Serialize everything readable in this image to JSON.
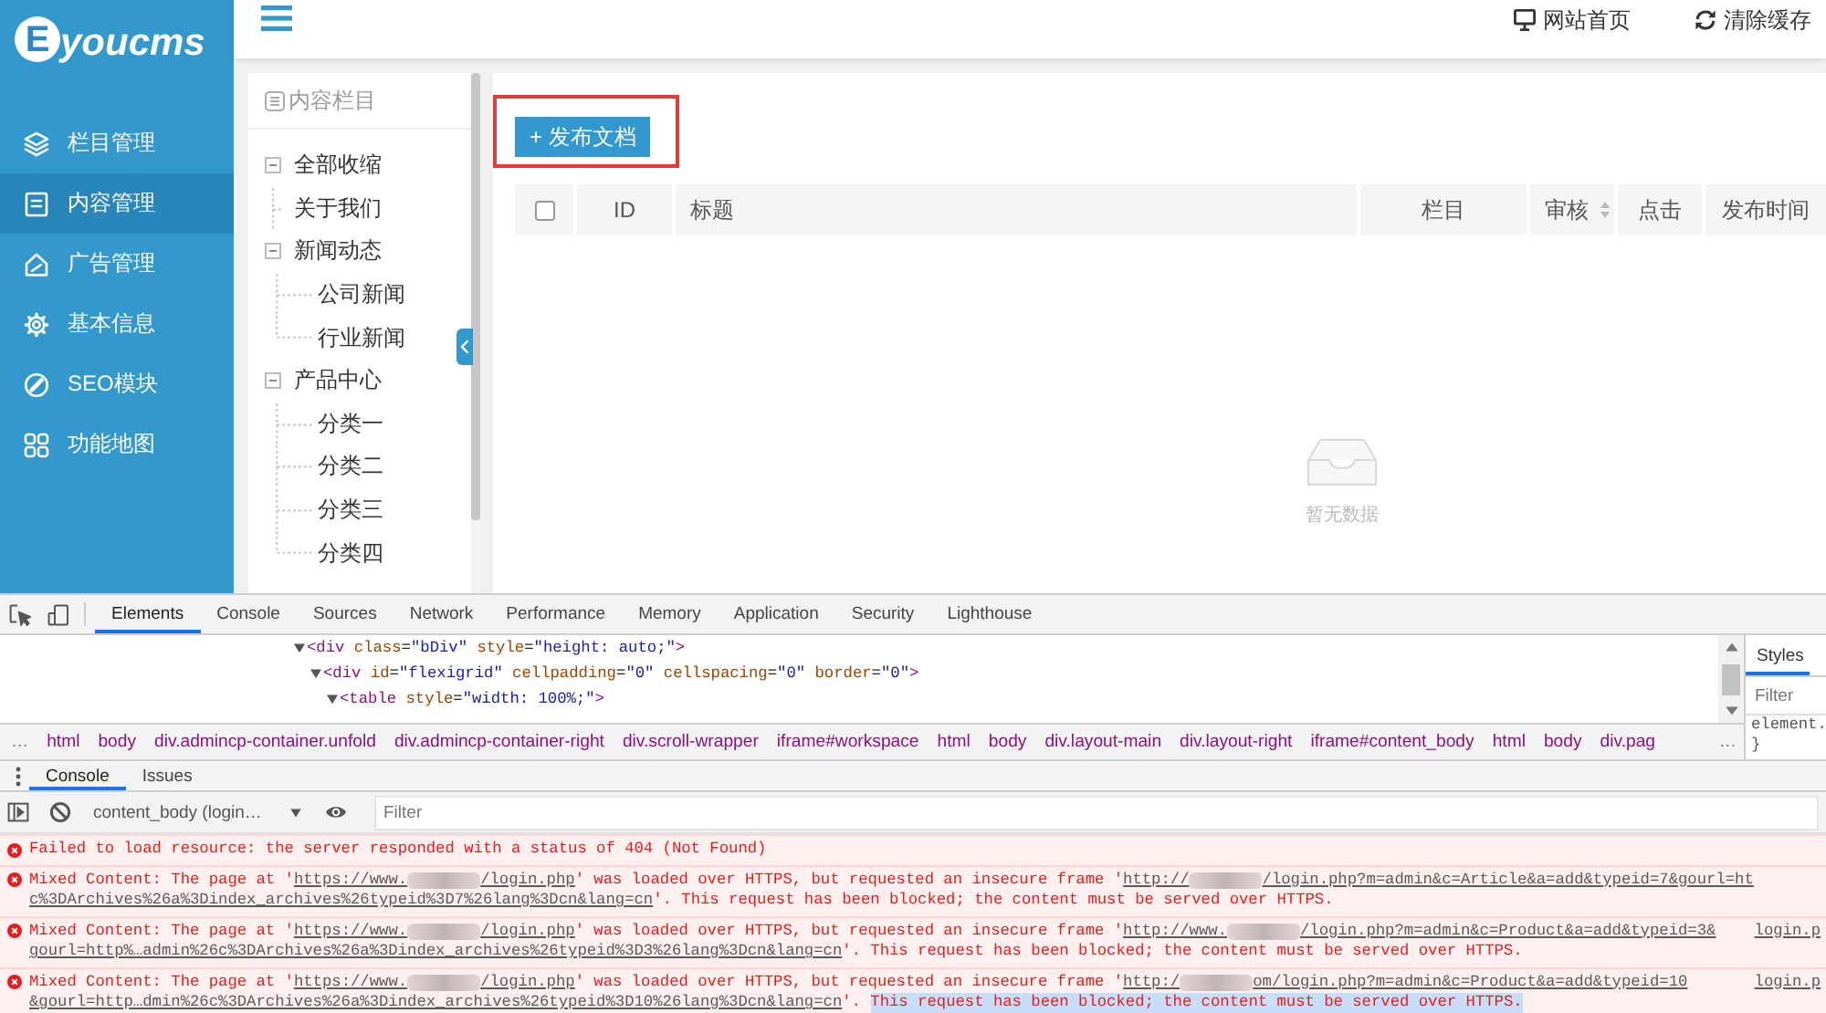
{
  "sidebar": {
    "logo": {
      "badge": "E",
      "text": "youcms"
    },
    "items": [
      {
        "label": "栏目管理",
        "selected": false
      },
      {
        "label": "内容管理",
        "selected": true
      },
      {
        "label": "广告管理",
        "selected": false
      },
      {
        "label": "基本信息",
        "selected": false
      },
      {
        "label": "SEO模块",
        "selected": false
      },
      {
        "label": "功能地图",
        "selected": false
      }
    ]
  },
  "header": {
    "links": [
      {
        "label": "网站首页"
      },
      {
        "label": "清除缓存"
      }
    ]
  },
  "category_tree": {
    "title": "内容栏目",
    "collapse_all": {
      "label": "全部收缩",
      "expanded": true
    },
    "nodes": [
      {
        "label": "关于我们"
      },
      {
        "label": "新闻动态",
        "expanded": true,
        "children": [
          {
            "label": "公司新闻"
          },
          {
            "label": "行业新闻"
          }
        ]
      },
      {
        "label": "产品中心",
        "expanded": true,
        "children": [
          {
            "label": "分类一"
          },
          {
            "label": "分类二"
          },
          {
            "label": "分类三"
          },
          {
            "label": "分类四"
          }
        ]
      }
    ]
  },
  "content": {
    "publish_button": {
      "label": "+ 发布文档",
      "highlighted": true
    },
    "table": {
      "columns": [
        {
          "kind": "checkbox",
          "checked": false
        },
        {
          "kind": "text",
          "label": "ID",
          "sortable": false
        },
        {
          "kind": "text",
          "label": "标题",
          "sortable": false
        },
        {
          "kind": "text",
          "label": "栏目",
          "sortable": false
        },
        {
          "kind": "text",
          "label": "审核",
          "sortable": true
        },
        {
          "kind": "text",
          "label": "点击",
          "sortable": false
        },
        {
          "kind": "text",
          "label": "发布时间",
          "sortable": false
        }
      ],
      "empty_text": "暂无数据"
    }
  },
  "devtools": {
    "tabs": [
      {
        "label": "Elements",
        "selected": true
      },
      {
        "label": "Console",
        "selected": false
      },
      {
        "label": "Sources",
        "selected": false
      },
      {
        "label": "Network",
        "selected": false
      },
      {
        "label": "Performance",
        "selected": false
      },
      {
        "label": "Memory",
        "selected": false
      },
      {
        "label": "Application",
        "selected": false
      },
      {
        "label": "Security",
        "selected": false
      },
      {
        "label": "Lighthouse",
        "selected": false
      }
    ],
    "dom_tree": [
      {
        "text": "<div class=\"bDiv\" style=\"height: auto;\">",
        "expanded": true,
        "children": [
          {
            "text": "<div id=\"flexigrid\" cellpadding=\"0\" cellspacing=\"0\" border=\"0\">",
            "expanded": true,
            "children": [
              {
                "text": "<table style=\"width: 100%;\">",
                "expanded": true
              }
            ]
          }
        ]
      }
    ],
    "breadcrumbs": {
      "scroll_left": "…",
      "items": [
        "html",
        "body",
        "div.admincp-container.unfold",
        "div.admincp-container-right",
        "div.scroll-wrapper",
        "iframe#workspace",
        "html",
        "body",
        "div.layout-main",
        "div.layout-right",
        "iframe#content_body",
        "html",
        "body",
        "div.pag"
      ],
      "scroll_right": "…"
    },
    "styles_pane": {
      "tabs": [
        {
          "label": "Styles",
          "selected": true
        }
      ],
      "filter_placeholder": "Filter",
      "rule_lines": [
        "element.",
        "}"
      ]
    },
    "drawer": {
      "tabs": [
        {
          "label": "Console",
          "selected": true
        },
        {
          "label": "Issues",
          "selected": false
        }
      ],
      "context": "content_body (login…",
      "filter_placeholder": "Filter",
      "messages": [
        {
          "kind": "error",
          "lines": [
            [
              {
                "kind": "text",
                "text": "Failed to load resource: the server responded with a status of 404 (Not Found)"
              }
            ]
          ]
        },
        {
          "kind": "error",
          "lines": [
            [
              {
                "kind": "text",
                "text": "Mixed Content: The page at '"
              },
              {
                "kind": "link",
                "text": "https://www."
              },
              {
                "kind": "redacted"
              },
              {
                "kind": "link",
                "text": "/login.php"
              },
              {
                "kind": "text",
                "text": "' was loaded over HTTPS, but requested an insecure frame '"
              },
              {
                "kind": "link",
                "text": "http://"
              },
              {
                "kind": "redacted"
              },
              {
                "kind": "link",
                "text": "/login.php?m=admin&c=Article&a=add&typeid=7&gourl=ht"
              }
            ],
            [
              {
                "kind": "link",
                "text": "c%3DArchives%26a%3Dindex_archives%26typeid%3D7%26lang%3Dcn&lang=cn"
              },
              {
                "kind": "text",
                "text": "'. This request has been blocked; the content must be served over HTTPS."
              }
            ]
          ]
        },
        {
          "kind": "error",
          "lines": [
            [
              {
                "kind": "text",
                "text": "Mixed Content: The page at '"
              },
              {
                "kind": "link",
                "text": "https://www."
              },
              {
                "kind": "redacted"
              },
              {
                "kind": "link",
                "text": "/login.php"
              },
              {
                "kind": "text",
                "text": "' was loaded over HTTPS, but requested an insecure frame '"
              },
              {
                "kind": "link",
                "text": "http://www."
              },
              {
                "kind": "redacted"
              },
              {
                "kind": "link",
                "text": "/login.php?m=admin&c=Product&a=add&typeid=3&"
              },
              {
                "kind": "source",
                "text": "login.p"
              }
            ],
            [
              {
                "kind": "link",
                "text": "gourl=http%…admin%26c%3DArchives%26a%3Dindex_archives%26typeid%3D3%26lang%3Dcn&lang=cn"
              },
              {
                "kind": "text",
                "text": "'. This request has been blocked; the content must be served over HTTPS."
              }
            ]
          ]
        },
        {
          "kind": "error",
          "lines": [
            [
              {
                "kind": "text",
                "text": "Mixed Content: The page at '"
              },
              {
                "kind": "link",
                "text": "https://www."
              },
              {
                "kind": "redacted"
              },
              {
                "kind": "link",
                "text": "/login.php"
              },
              {
                "kind": "text",
                "text": "' was loaded over HTTPS, but requested an insecure frame '"
              },
              {
                "kind": "link",
                "text": "http:/"
              },
              {
                "kind": "redacted"
              },
              {
                "kind": "link",
                "text": "om/login.php?m=admin&c=Product&a=add&typeid=10"
              },
              {
                "kind": "source",
                "text": "login.p"
              }
            ],
            [
              {
                "kind": "link",
                "text": "&gourl=http…dmin%26c%3DArchives%26a%3Dindex_archives%26typeid%3D10%26lang%3Dcn&lang=cn"
              },
              {
                "kind": "text",
                "text": "'. "
              },
              {
                "kind": "selection",
                "text": "This request has been blocked; the content must be served over HTTPS."
              }
            ]
          ]
        }
      ]
    }
  }
}
